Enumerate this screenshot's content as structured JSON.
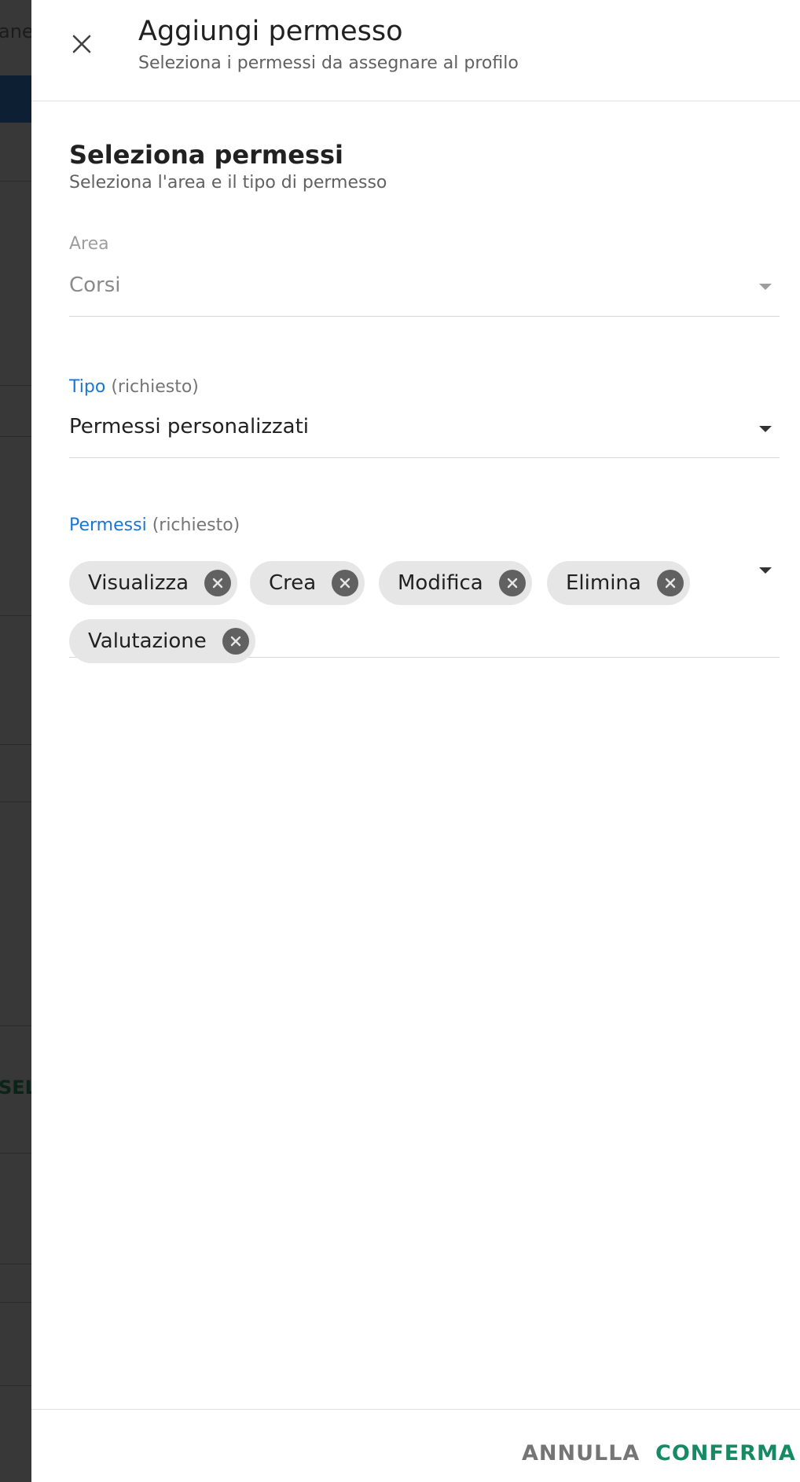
{
  "background": {
    "top_fragment": "ane",
    "side_fragment": "SEL"
  },
  "drawer": {
    "title": "Aggiungi permesso",
    "subtitle": "Seleziona i permessi da assegnare al profilo",
    "close_icon": "close-icon"
  },
  "section": {
    "title": "Seleziona permessi",
    "subtitle": "Seleziona l'area e il tipo di permesso"
  },
  "fields": {
    "area": {
      "label": "Area",
      "value": "Corsi",
      "disabled": true
    },
    "tipo": {
      "label": "Tipo",
      "required": "(richiesto)",
      "value": "Permessi personalizzati"
    },
    "permessi": {
      "label": "Permessi",
      "required": "(richiesto)",
      "chips": [
        "Visualizza",
        "Crea",
        "Modifica",
        "Elimina",
        "Valutazione"
      ]
    }
  },
  "footer": {
    "cancel_label": "ANNULLA",
    "confirm_label": "CONFERMA"
  },
  "colors": {
    "accent_blue": "#1976d2",
    "confirm_green": "#168b63",
    "chip_bg": "#e6e6e6",
    "overlay": "#383838"
  }
}
